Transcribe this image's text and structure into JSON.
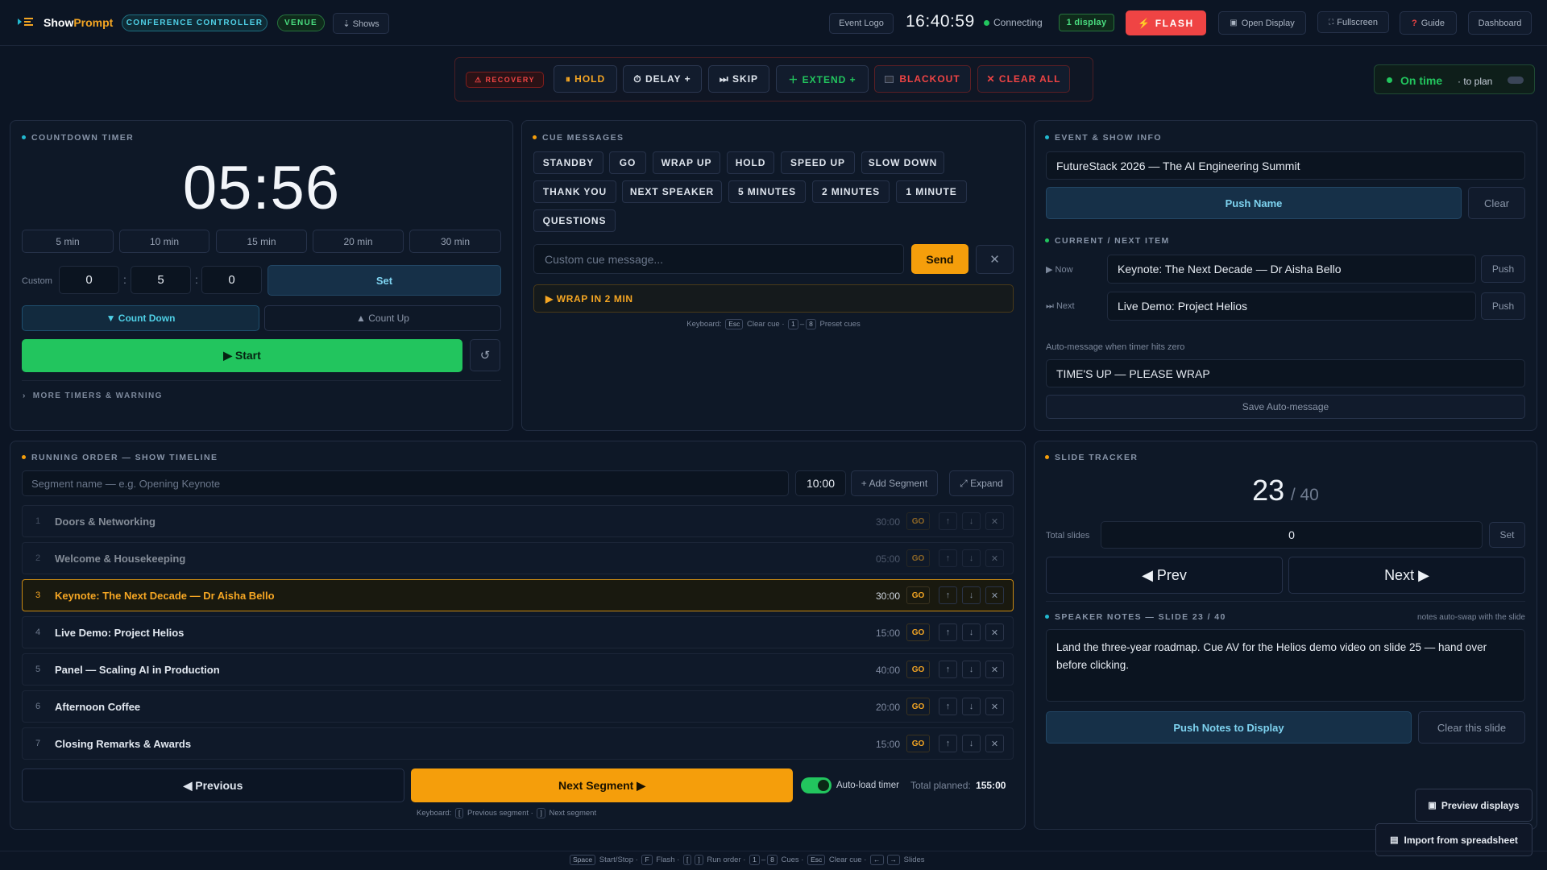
{
  "app": {
    "logo_show": "Show",
    "logo_prompt": "Prompt",
    "badge_controller": "CONFERENCE CONTROLLER",
    "badge_venue": "VENUE",
    "shows_btn": "⇣ Shows",
    "event_logo_btn": "Event Logo",
    "clock": "16:40:59",
    "status_text": "Connecting",
    "display_badge": "1 display",
    "flash_btn": "⚡  FLASH",
    "open_display_btn": "Open Display",
    "fullscreen_btn": "Fullscreen",
    "guide_btn": "Guide",
    "dashboard_btn": "Dashboard"
  },
  "actions": {
    "recovery": "⚠ RECOVERY",
    "hold": "⏸ HOLD",
    "delay": "⏱ DELAY +",
    "skip": "⏭ SKIP",
    "extend": "＋ EXTEND +",
    "blackout": "BLACKOUT",
    "clear_all": "✕ CLEAR ALL"
  },
  "plan_status": {
    "label": "On time",
    "sub": "· to plan"
  },
  "countdown": {
    "title": "COUNTDOWN TIMER",
    "time": "05:56",
    "presets": [
      "5 min",
      "10 min",
      "15 min",
      "20 min",
      "30 min"
    ],
    "custom_label": "Custom",
    "custom_h": "0",
    "custom_m": "5",
    "custom_s": "0",
    "set_label": "Set",
    "count_down": "▼ Count Down",
    "count_up": "▲ Count Up",
    "start": "▶ Start",
    "more": "MORE TIMERS & WARNING"
  },
  "cues": {
    "title": "CUE MESSAGES",
    "presets_row1": [
      "STANDBY",
      "GO",
      "WRAP UP",
      "HOLD",
      "SPEED UP",
      "SLOW DOWN"
    ],
    "presets_row2": [
      "THANK YOU",
      "NEXT SPEAKER",
      "5 MINUTES",
      "2 MINUTES",
      "1 MINUTE"
    ],
    "presets_row3": [
      "QUESTIONS"
    ],
    "custom_placeholder": "Custom cue message...",
    "send": "Send",
    "active_cue": "▶ WRAP IN 2 MIN",
    "kb_label": "Keyboard:",
    "kb_esc": "Esc",
    "kb_clear": "Clear cue ·",
    "kb_1": "1",
    "kb_dash": "–",
    "kb_8": "8",
    "kb_preset": "Preset cues"
  },
  "event": {
    "title": "EVENT & SHOW INFO",
    "name": "FutureStack 2026 — The AI Engineering Summit",
    "push_name": "Push Name",
    "clear": "Clear",
    "current_title": "CURRENT / NEXT ITEM",
    "now_label": "▶ Now",
    "now_value": "Keynote: The Next Decade — Dr Aisha Bello",
    "next_label": "⏭ Next",
    "next_value": "Live Demo: Project Helios",
    "push": "Push",
    "auto_label": "Auto-message when timer hits zero",
    "auto_value": "TIME'S UP — PLEASE WRAP",
    "save_auto": "Save Auto-message"
  },
  "timeline": {
    "title": "RUNNING ORDER — SHOW TIMELINE",
    "seg_placeholder": "Segment name — e.g. Opening Keynote",
    "seg_duration": "10:00",
    "add_segment": "+ Add Segment",
    "expand": "⤢ Expand",
    "segments": [
      {
        "num": "1",
        "name": "Doors & Networking",
        "dur": "30:00"
      },
      {
        "num": "2",
        "name": "Welcome & Housekeeping",
        "dur": "05:00"
      },
      {
        "num": "3",
        "name": "Keynote: The Next Decade — Dr Aisha Bello",
        "dur": "30:00"
      },
      {
        "num": "4",
        "name": "Live Demo: Project Helios",
        "dur": "15:00"
      },
      {
        "num": "5",
        "name": "Panel — Scaling AI in Production",
        "dur": "40:00"
      },
      {
        "num": "6",
        "name": "Afternoon Coffee",
        "dur": "20:00"
      },
      {
        "num": "7",
        "name": "Closing Remarks & Awards",
        "dur": "15:00"
      }
    ],
    "go": "GO",
    "previous": "◀ Previous",
    "next_segment": "Next Segment ▶",
    "auto_load": "Auto-load timer",
    "total_label": "Total planned:",
    "total_value": "155:00",
    "kb_label": "Keyboard:",
    "kb_prev_key": "[",
    "kb_prev": "Previous segment ·",
    "kb_next_key": "]",
    "kb_next": "Next segment"
  },
  "slides": {
    "title": "SLIDE TRACKER",
    "current": "23",
    "total": "/ 40",
    "total_label": "Total slides",
    "total_value": "0",
    "set": "Set",
    "prev": "◀ Prev",
    "next": "Next ▶",
    "notes_title": "SPEAKER NOTES — SLIDE 23 / 40",
    "notes_hint": "notes auto-swap with the slide",
    "notes_text": "Land the three-year roadmap. Cue AV for the Helios demo video on slide 25 — hand over before clicking.",
    "push_notes": "Push Notes to Display",
    "clear_slide": "Clear this slide"
  },
  "floating": {
    "preview": "Preview displays",
    "import": "Import from spreadsheet"
  },
  "footer": {
    "k_space": "Space",
    "t_start": "Start/Stop ·",
    "k_f": "F",
    "t_flash": "Flash ·",
    "k_lb": "[",
    "k_rb": "]",
    "t_run": "Run order ·",
    "k_1": "1",
    "k_dash": "–",
    "k_8": "8",
    "t_cues": "Cues ·",
    "k_esc": "Esc",
    "t_clear": "Clear cue ·",
    "k_left": "←",
    "k_right": "→",
    "t_slides": "Slides"
  },
  "colors": {
    "background": "#0c1524",
    "accent_orange": "#f5a623",
    "accent_green": "#22c55e",
    "accent_red": "#ef4444",
    "accent_teal": "#22b8cf"
  }
}
